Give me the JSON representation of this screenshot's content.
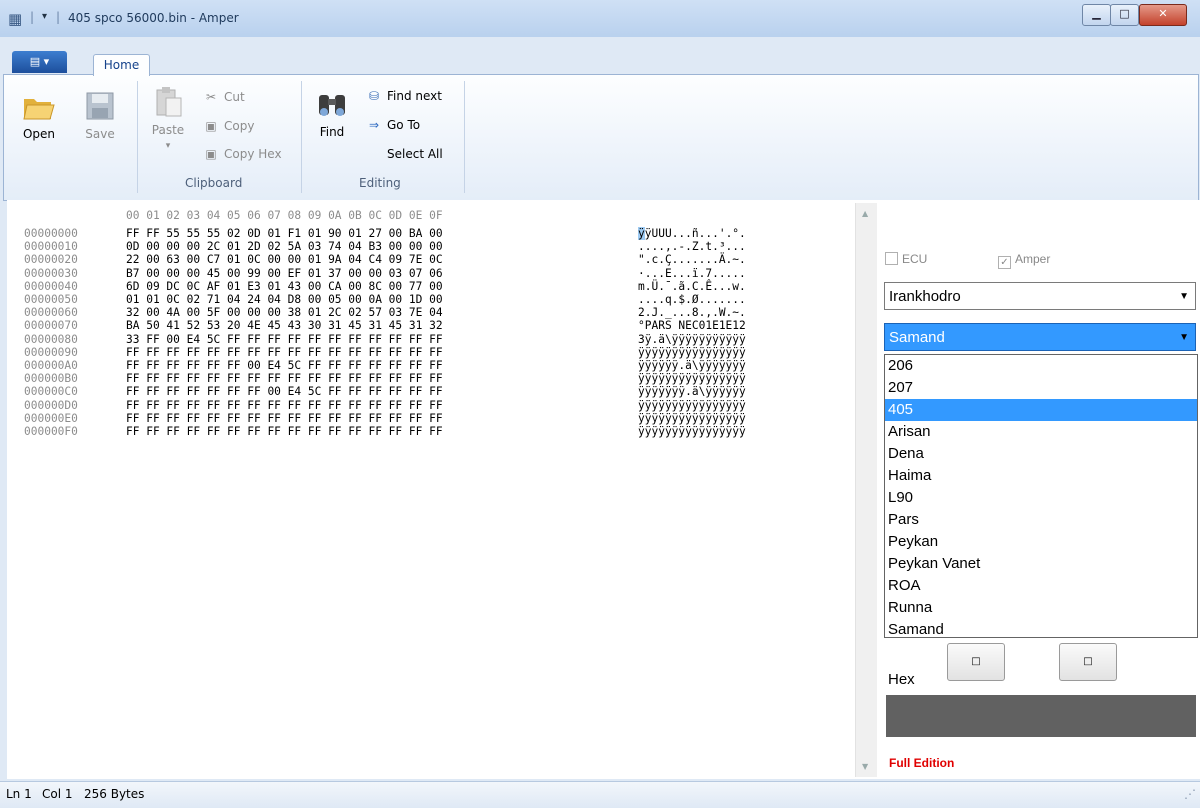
{
  "window": {
    "title": "405 spco 56000.bin - Amper",
    "app_icon": "grid-icon",
    "min": "▁",
    "max": "□",
    "close": "✕"
  },
  "quick_access": {
    "arrow": "▾"
  },
  "app_menu": {
    "label": "▤ ▾"
  },
  "tabs": [
    {
      "label": "Home"
    }
  ],
  "ribbon": {
    "open": "Open",
    "save": "Save",
    "paste": "Paste",
    "paste_arrow": "▾",
    "cut": "Cut",
    "copy": "Copy",
    "copy_hex": "Copy Hex",
    "find": "Find",
    "find_next": "Find next",
    "go_to": "Go To",
    "select_all": "Select All",
    "groups": {
      "clipboard": "Clipboard",
      "editing": "Editing"
    }
  },
  "hex": {
    "header": "00 01 02 03 04 05 06 07 08 09 0A 0B 0C 0D 0E 0F",
    "rows": [
      {
        "addr": "00000000",
        "bytes": "FF FF 55 55 55 02 0D 01 F1 01 90 01 27 00 BA 00",
        "ascii_first": "ÿ",
        "ascii_rest": "ÿUUU...ñ...'.°."
      },
      {
        "addr": "00000010",
        "bytes": "0D 00 00 00 2C 01 2D 02 5A 03 74 04 B3 00 00 00",
        "ascii": "....,.-.Z.t.³..."
      },
      {
        "addr": "00000020",
        "bytes": "22 00 63 00 C7 01 0C 00 00 01 9A 04 C4 09 7E 0C",
        "ascii": "\".c.Ç.......Ä.~."
      },
      {
        "addr": "00000030",
        "bytes": "B7 00 00 00 45 00 99 00 EF 01 37 00 00 03 07 06",
        "ascii": "·...E...ï.7....."
      },
      {
        "addr": "00000040",
        "bytes": "6D 09 DC 0C AF 01 E3 01 43 00 CA 00 8C 00 77 00",
        "ascii": "m.Ü.¯.ã.C.Ê...w."
      },
      {
        "addr": "00000050",
        "bytes": "01 01 0C 02 71 04 24 04 D8 00 05 00 0A 00 1D 00",
        "ascii": "....q.$.Ø......."
      },
      {
        "addr": "00000060",
        "bytes": "32 00 4A 00 5F 00 00 00 38 01 2C 02 57 03 7E 04",
        "ascii": "2.J._...8.,.W.~."
      },
      {
        "addr": "00000070",
        "bytes": "BA 50 41 52 53 20 4E 45 43 30 31 45 31 45 31 32",
        "ascii": "°PARS NEC01E1E12"
      },
      {
        "addr": "00000080",
        "bytes": "33 FF 00 E4 5C FF FF FF FF FF FF FF FF FF FF FF",
        "ascii": "3ÿ.ä\\ÿÿÿÿÿÿÿÿÿÿÿ"
      },
      {
        "addr": "00000090",
        "bytes": "FF FF FF FF FF FF FF FF FF FF FF FF FF FF FF FF",
        "ascii": "ÿÿÿÿÿÿÿÿÿÿÿÿÿÿÿÿ"
      },
      {
        "addr": "000000A0",
        "bytes": "FF FF FF FF FF FF 00 E4 5C FF FF FF FF FF FF FF",
        "ascii": "ÿÿÿÿÿÿ.ä\\ÿÿÿÿÿÿÿ"
      },
      {
        "addr": "000000B0",
        "bytes": "FF FF FF FF FF FF FF FF FF FF FF FF FF FF FF FF",
        "ascii": "ÿÿÿÿÿÿÿÿÿÿÿÿÿÿÿÿ"
      },
      {
        "addr": "000000C0",
        "bytes": "FF FF FF FF FF FF FF 00 E4 5C FF FF FF FF FF FF",
        "ascii": "ÿÿÿÿÿÿÿ.ä\\ÿÿÿÿÿÿ"
      },
      {
        "addr": "000000D0",
        "bytes": "FF FF FF FF FF FF FF FF FF FF FF FF FF FF FF FF",
        "ascii": "ÿÿÿÿÿÿÿÿÿÿÿÿÿÿÿÿ"
      },
      {
        "addr": "000000E0",
        "bytes": "FF FF FF FF FF FF FF FF FF FF FF FF FF FF FF FF",
        "ascii": "ÿÿÿÿÿÿÿÿÿÿÿÿÿÿÿÿ"
      },
      {
        "addr": "000000F0",
        "bytes": "FF FF FF FF FF FF FF FF FF FF FF FF FF FF FF FF",
        "ascii": "ÿÿÿÿÿÿÿÿÿÿÿÿÿÿÿÿ"
      }
    ]
  },
  "side": {
    "ecu": "ECU",
    "amper": "Amper",
    "amper_checked": true,
    "ecu_checked": false,
    "manufacturer": "Irankhodro",
    "model": "Samand",
    "model_options": [
      "206",
      "207",
      "405",
      "Arisan",
      "Dena",
      "Haima",
      "L90",
      "Pars",
      "Peykan",
      "Peykan Vanet",
      "ROA",
      "Runna",
      "Samand"
    ],
    "highlighted_option": "405",
    "button_glyph": "□",
    "hex_label": "Hex",
    "edition": "Full Edition",
    "arrow": "▼"
  },
  "status": {
    "line": "Ln 1",
    "col": "Col 1",
    "size": "256 Bytes"
  },
  "scroll": {
    "up": "▲",
    "down": "▼"
  },
  "colors": {
    "selection": "#3399ff",
    "edition": "#e00000",
    "ribbon_border": "#9cb4d4"
  }
}
